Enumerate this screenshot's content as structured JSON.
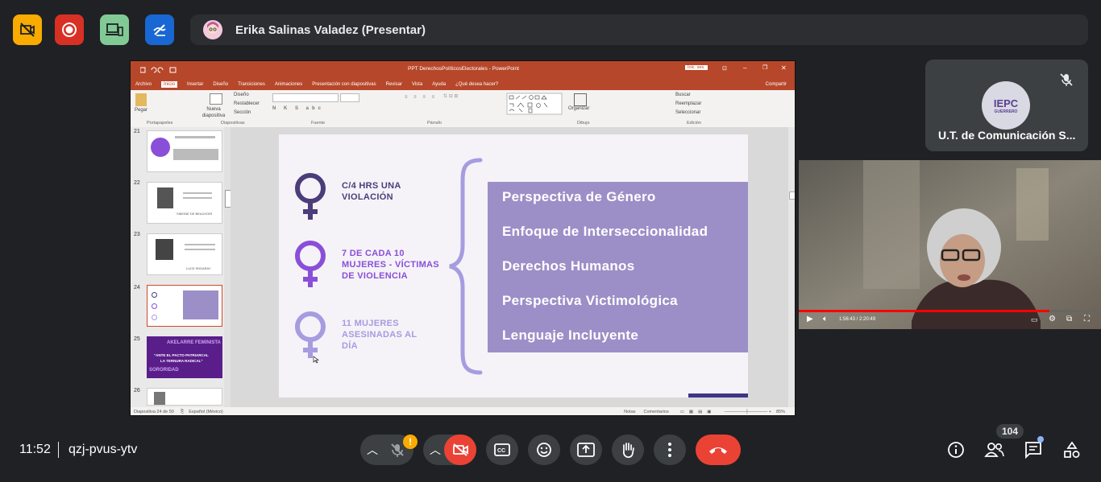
{
  "top_buttons": {
    "icons": [
      "no-video-icon",
      "record-icon",
      "devices-icon",
      "draw-icon"
    ],
    "colors": [
      "#f9ab00",
      "#d93025",
      "#81c995",
      "#1967d2"
    ]
  },
  "presenter": {
    "name": "Erika Salinas Valadez (Presentar)"
  },
  "powerpoint": {
    "window_title": "PPT DerechosPolíticosElectorales - PowerPoint",
    "signin": "Inic. ses.",
    "tabs": [
      "Archivo",
      "Inicio",
      "Insertar",
      "Diseño",
      "Transiciones",
      "Animaciones",
      "Presentación con diapositivas",
      "Revisar",
      "Vista",
      "Ayuda",
      "¿Qué desea hacer?"
    ],
    "active_tab": "Inicio",
    "share_label": "Compartir",
    "ribbon": {
      "paste": "Pegar",
      "new_slide": "Nueva diapositiva",
      "layout": "Diseño",
      "reset": "Restablecer",
      "section": "Sección",
      "organize": "Organizar",
      "find": "Buscar",
      "replace": "Reemplazar",
      "select": "Seleccionar",
      "groups": [
        "Portapapeles",
        "Diapositivas",
        "Fuente",
        "Párrafo",
        "Dibujo",
        "Edición"
      ]
    },
    "thumbnails": [
      {
        "num": "21"
      },
      {
        "num": "22",
        "caption": "SIMONE DE BEAUVOIR"
      },
      {
        "num": "23",
        "caption": "LUCE IRIGARAY"
      },
      {
        "num": "24"
      },
      {
        "num": "25",
        "lines": [
          "AKELARRE FEMINISTA",
          "\"ANTE EL PACTO PATRIARCAL",
          "LA TERNURA RADICAL\"",
          "SORORIDAD"
        ]
      },
      {
        "num": "26"
      }
    ],
    "status_left": "Diapositiva 24 de 50",
    "status_lang": "Español (México)",
    "notes": "Notas",
    "comments": "Comentarios",
    "zoom": "85%"
  },
  "slide": {
    "stats": [
      [
        "C/4 HRS UNA",
        "VIOLACIÓN"
      ],
      [
        "7 DE CADA 10",
        "MUJERES - VÍCTIMAS",
        "DE VIOLENCIA"
      ],
      [
        "11 MUJERES",
        "ASESINADAS AL",
        "DÍA"
      ]
    ],
    "stat_colors": [
      "#4a3d7a",
      "#8a4fd8",
      "#a69ce0"
    ],
    "panel_color": "#9c8fc7",
    "panel_items": [
      "Perspectiva de Género",
      "Enfoque de Interseccionalidad",
      "Derechos Humanos",
      "Perspectiva Victimológica",
      "Lenguaje Incluyente"
    ]
  },
  "tile": {
    "name": "U.T. de Comunicación S...",
    "logo_text": "IEPC",
    "logo_sub": "GUERRERO"
  },
  "video": {
    "time": "1:56:43 / 2:20:49",
    "progress": 0.83
  },
  "bottom": {
    "time": "11:52",
    "meeting_code": "qzj-pvus-ytv",
    "participants_count": "104",
    "warning": "!"
  }
}
